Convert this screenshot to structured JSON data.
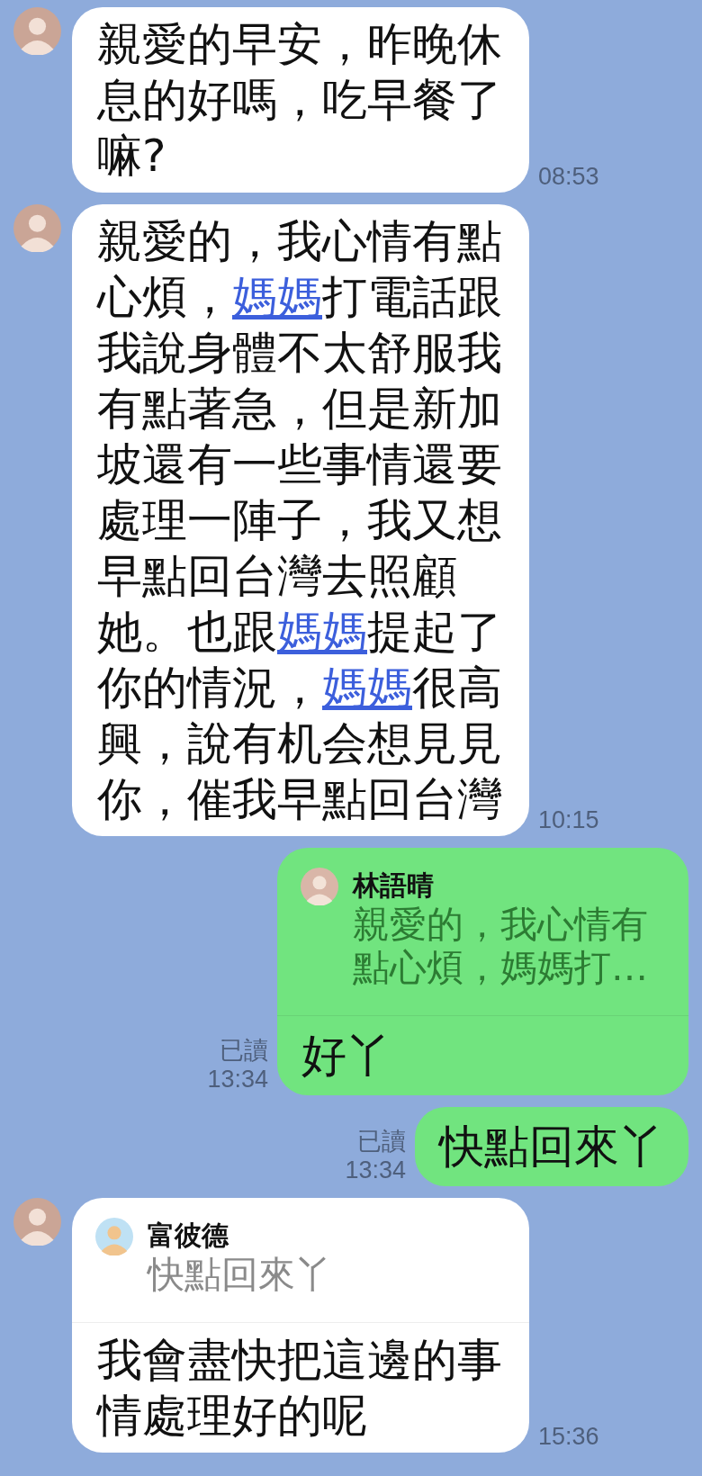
{
  "messages": [
    {
      "kind": "incoming",
      "parts": [
        {
          "kind": "text",
          "text": "親愛的早安，昨晚休息的好嗎，吃早餐了嘛?"
        }
      ],
      "time": "08:53"
    },
    {
      "kind": "incoming",
      "parts": [
        {
          "kind": "text",
          "text": "親愛的，我心情有點心煩，"
        },
        {
          "kind": "link",
          "text": "媽媽"
        },
        {
          "kind": "text",
          "text": "打電話跟我說身體不太舒服我有點著急，但是新加坡還有一些事情還要處理一陣子，我又想早點回台灣去照顧她。也跟"
        },
        {
          "kind": "link",
          "text": "媽媽"
        },
        {
          "kind": "text",
          "text": "提起了你的情況，"
        },
        {
          "kind": "link",
          "text": "媽媽"
        },
        {
          "kind": "text",
          "text": "很高興，說有机会想見見你，催我早點回台灣"
        }
      ],
      "time": "10:15"
    },
    {
      "kind": "outgoing",
      "reply": {
        "name": "林語晴",
        "text": "親愛的，我心情有點心煩，媽媽打…"
      },
      "parts": [
        {
          "kind": "text",
          "text": "好丫"
        }
      ],
      "read_label": "已讀",
      "time": "13:34"
    },
    {
      "kind": "outgoing",
      "parts": [
        {
          "kind": "text",
          "text": "快點回來丫"
        }
      ],
      "read_label": "已讀",
      "time": "13:34"
    },
    {
      "kind": "incoming",
      "reply": {
        "name": "富彼德",
        "text": "快點回來丫"
      },
      "parts": [
        {
          "kind": "text",
          "text": "我會盡快把這邊的事情處理好的呢"
        }
      ],
      "time": "15:36"
    }
  ]
}
